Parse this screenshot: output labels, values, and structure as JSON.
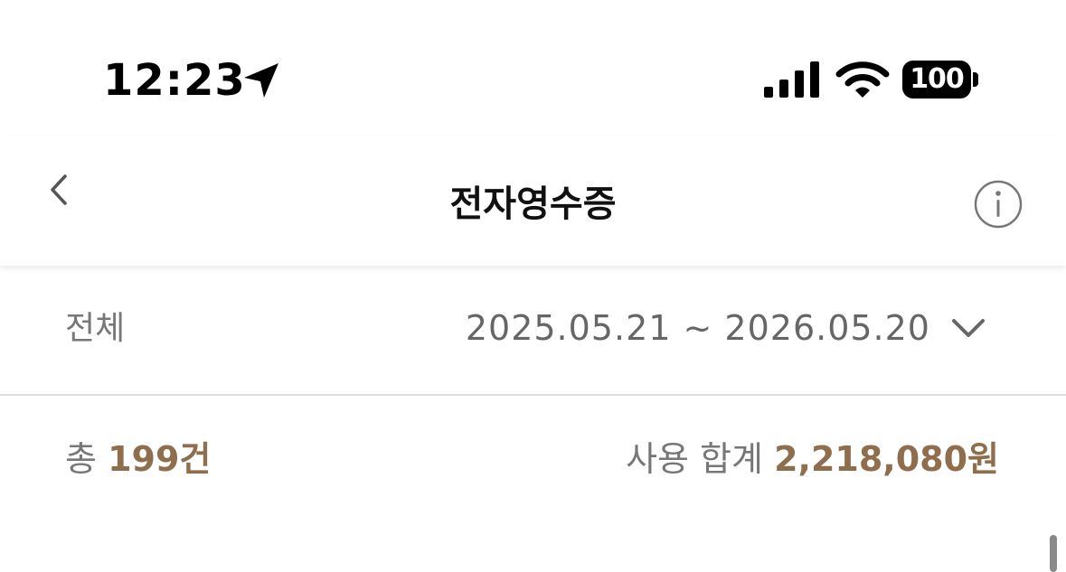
{
  "status_bar": {
    "time": "12:23",
    "battery_level": "100",
    "icons": [
      "location-arrow-icon",
      "cellular-signal-icon",
      "wifi-icon",
      "battery-icon"
    ]
  },
  "header": {
    "title": "전자영수증",
    "back_icon": "chevron-left-icon",
    "info_icon": "info-circle-icon"
  },
  "filter": {
    "category": "전체",
    "date_range": "2025.05.21 ~ 2026.05.20",
    "dropdown_icon": "chevron-down-icon"
  },
  "summary": {
    "total_label": "총",
    "total_count": "199건",
    "sum_label": "사용 합계",
    "sum_amount": "2,218,080원"
  },
  "colors": {
    "accent": "#8e6e4d",
    "muted_text": "#777777",
    "divider": "#dedede"
  }
}
